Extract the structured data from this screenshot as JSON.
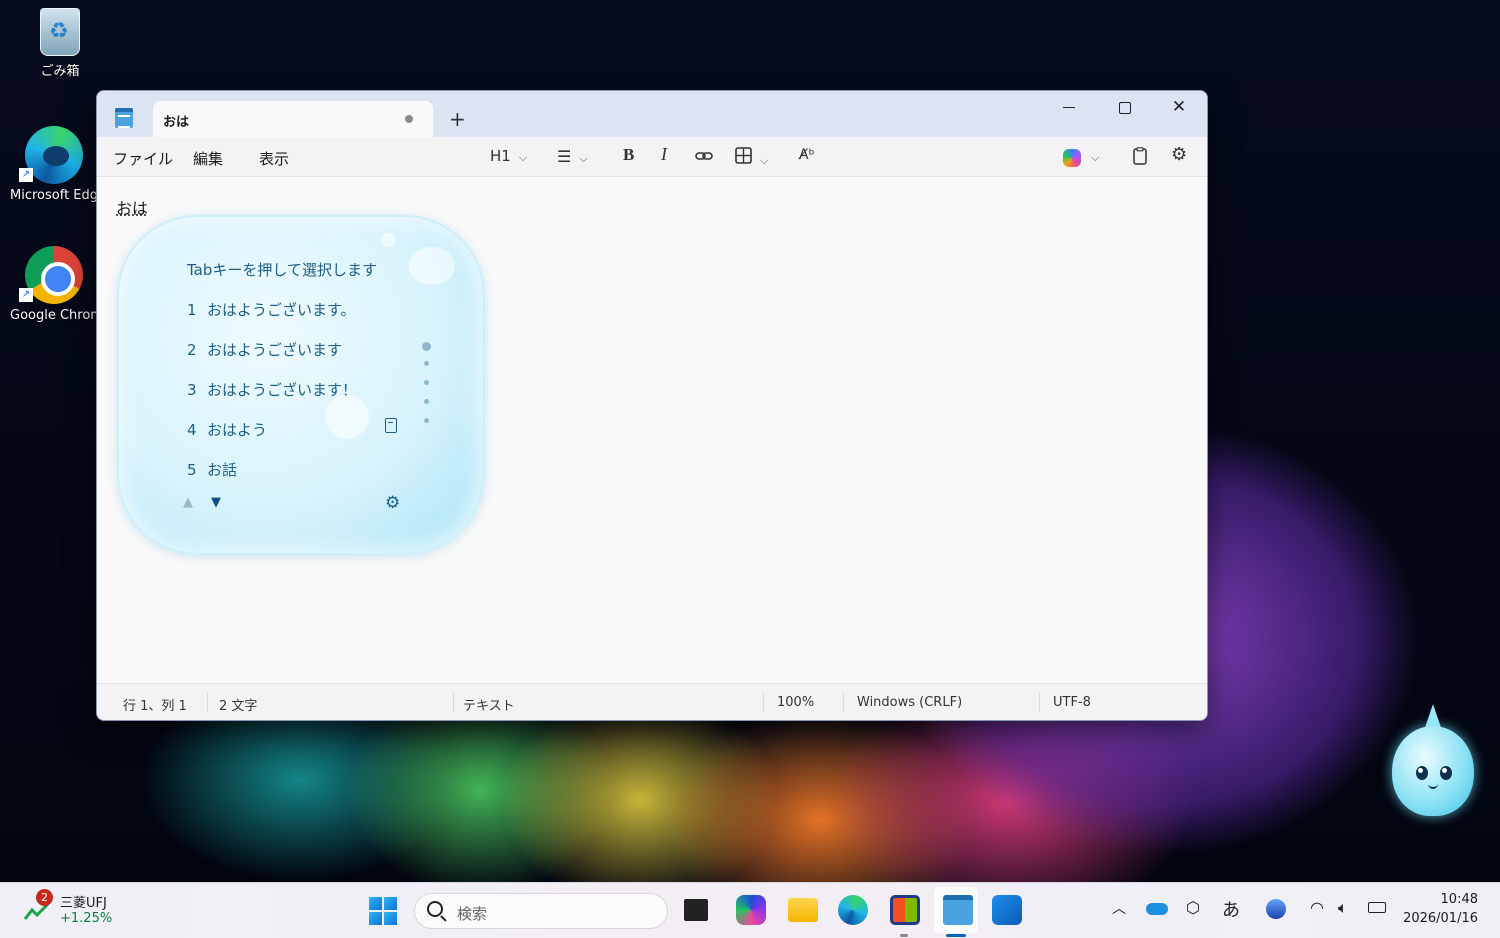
{
  "desktop": {
    "icons": [
      {
        "label": "ごみ箱",
        "icon": "recycle-bin-icon"
      },
      {
        "label": "Microsoft Edge",
        "icon": "edge-icon"
      },
      {
        "label": "Google Chrome",
        "icon": "chrome-icon"
      }
    ]
  },
  "window": {
    "tab_title": "おは",
    "new_tab_label": "+",
    "controls": {
      "minimize": "minimize",
      "maximize": "maximize",
      "close": "✕"
    }
  },
  "menu": {
    "file": "ファイル",
    "edit": "編集",
    "view": "表示"
  },
  "toolbar": {
    "heading": "H1",
    "bold": "B",
    "italic": "I"
  },
  "editor": {
    "text": "おは"
  },
  "ime": {
    "hint": "Tabキーを押して選択します",
    "candidates": [
      {
        "num": "1",
        "text": "おはようございます。"
      },
      {
        "num": "2",
        "text": "おはようございます"
      },
      {
        "num": "3",
        "text": "おはようございます！"
      },
      {
        "num": "4",
        "text": "おはよう"
      },
      {
        "num": "5",
        "text": "お話"
      }
    ],
    "page_up": "▲",
    "page_down": "▼"
  },
  "status": {
    "position": "行 1、列 1",
    "chars": "2 文字",
    "format": "テキスト",
    "zoom": "100%",
    "line_ending": "Windows (CRLF)",
    "encoding": "UTF-8"
  },
  "taskbar": {
    "widget": {
      "badge": "2",
      "name": "三菱UFJ",
      "value": "+1.25%"
    },
    "search_placeholder": "検索",
    "ime_mode": "あ",
    "time": "10:48",
    "date": "2026/01/16"
  }
}
